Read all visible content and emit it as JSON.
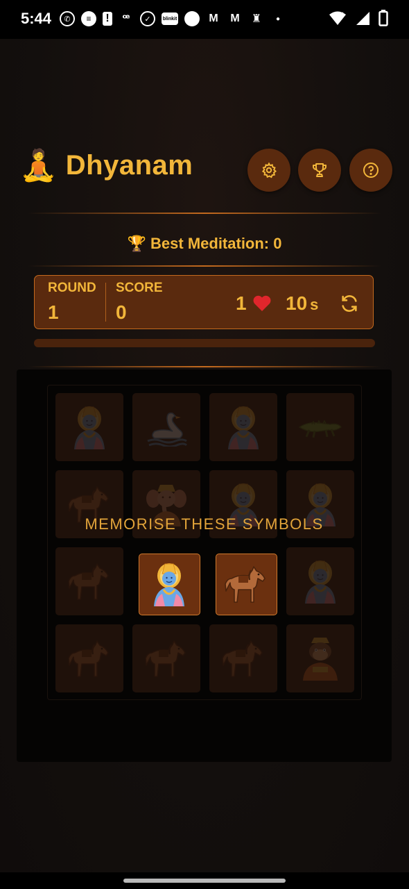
{
  "status_bar": {
    "time": "5:44",
    "icons": [
      "whatsapp-icon",
      "message-icon",
      "alert-icon",
      "swiggy-icon",
      "check-circle-icon",
      "blinkit-icon",
      "circle-icon",
      "gmail-icon",
      "gmail-icon",
      "keyhole-icon",
      "dot-icon"
    ],
    "blinkit_label": "blinkit",
    "right_icons": [
      "wifi-icon",
      "signal-icon",
      "battery-icon"
    ]
  },
  "header": {
    "logo_emoji": "🧘",
    "title": "Dhyanam",
    "buttons": [
      "settings-icon",
      "trophy-icon",
      "help-icon"
    ]
  },
  "best": {
    "text": "🏆 Best Meditation: 0"
  },
  "stats": {
    "round_label": "ROUND",
    "round_value": "1",
    "score_label": "SCORE",
    "score_value": "0",
    "lives_value": "1",
    "lives_icon": "heart-icon",
    "timer_value": "10",
    "timer_unit": "s",
    "restart_icon": "refresh-icon"
  },
  "progress": {
    "fraction": 0
  },
  "board": {
    "message": "MEMORISE THESE SYMBOLS",
    "cells": [
      {
        "symbol": "vishnu",
        "revealed": false
      },
      {
        "symbol": "swan",
        "revealed": false
      },
      {
        "symbol": "vishnu",
        "revealed": false
      },
      {
        "symbol": "crocodile",
        "revealed": false
      },
      {
        "symbol": "horse",
        "revealed": false
      },
      {
        "symbol": "ganesha",
        "revealed": false
      },
      {
        "symbol": "vishnu",
        "revealed": false
      },
      {
        "symbol": "vishnu",
        "revealed": false
      },
      {
        "symbol": "horse",
        "revealed": false
      },
      {
        "symbol": "vishnu",
        "revealed": true
      },
      {
        "symbol": "horse",
        "revealed": true
      },
      {
        "symbol": "vishnu",
        "revealed": false
      },
      {
        "symbol": "horse",
        "revealed": false
      },
      {
        "symbol": "horse",
        "revealed": false
      },
      {
        "symbol": "horse",
        "revealed": false
      },
      {
        "symbol": "hanuman",
        "revealed": false
      }
    ]
  },
  "colors": {
    "accent": "#f2b63a",
    "panel": "#5a2a0e",
    "border": "#c46a1e",
    "background": "#14100e"
  }
}
